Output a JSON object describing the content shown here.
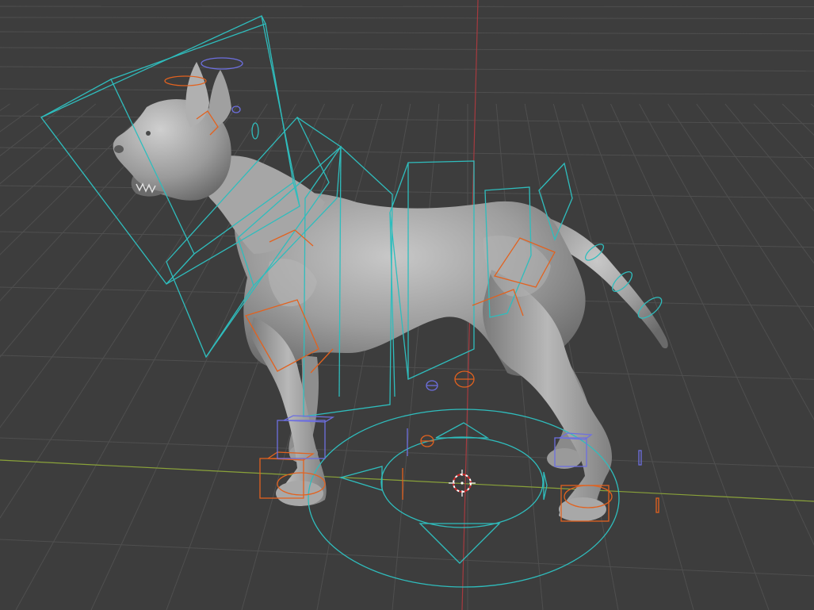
{
  "colors": {
    "background": "#3d3d3d",
    "grid_line": "#4f4f4f",
    "x_axis": "#8aa23a",
    "y_axis": "#a63a3f",
    "control_cyan": "#2fbdbd",
    "control_orange": "#e2621f",
    "control_blue": "#6d6fe0",
    "mesh_base": "#8f8f8f",
    "mesh_highlight": "#c4c4c4",
    "mesh_shadow": "#5e5e5e"
  },
  "icons": {
    "cursor": "3d-cursor-icon"
  }
}
